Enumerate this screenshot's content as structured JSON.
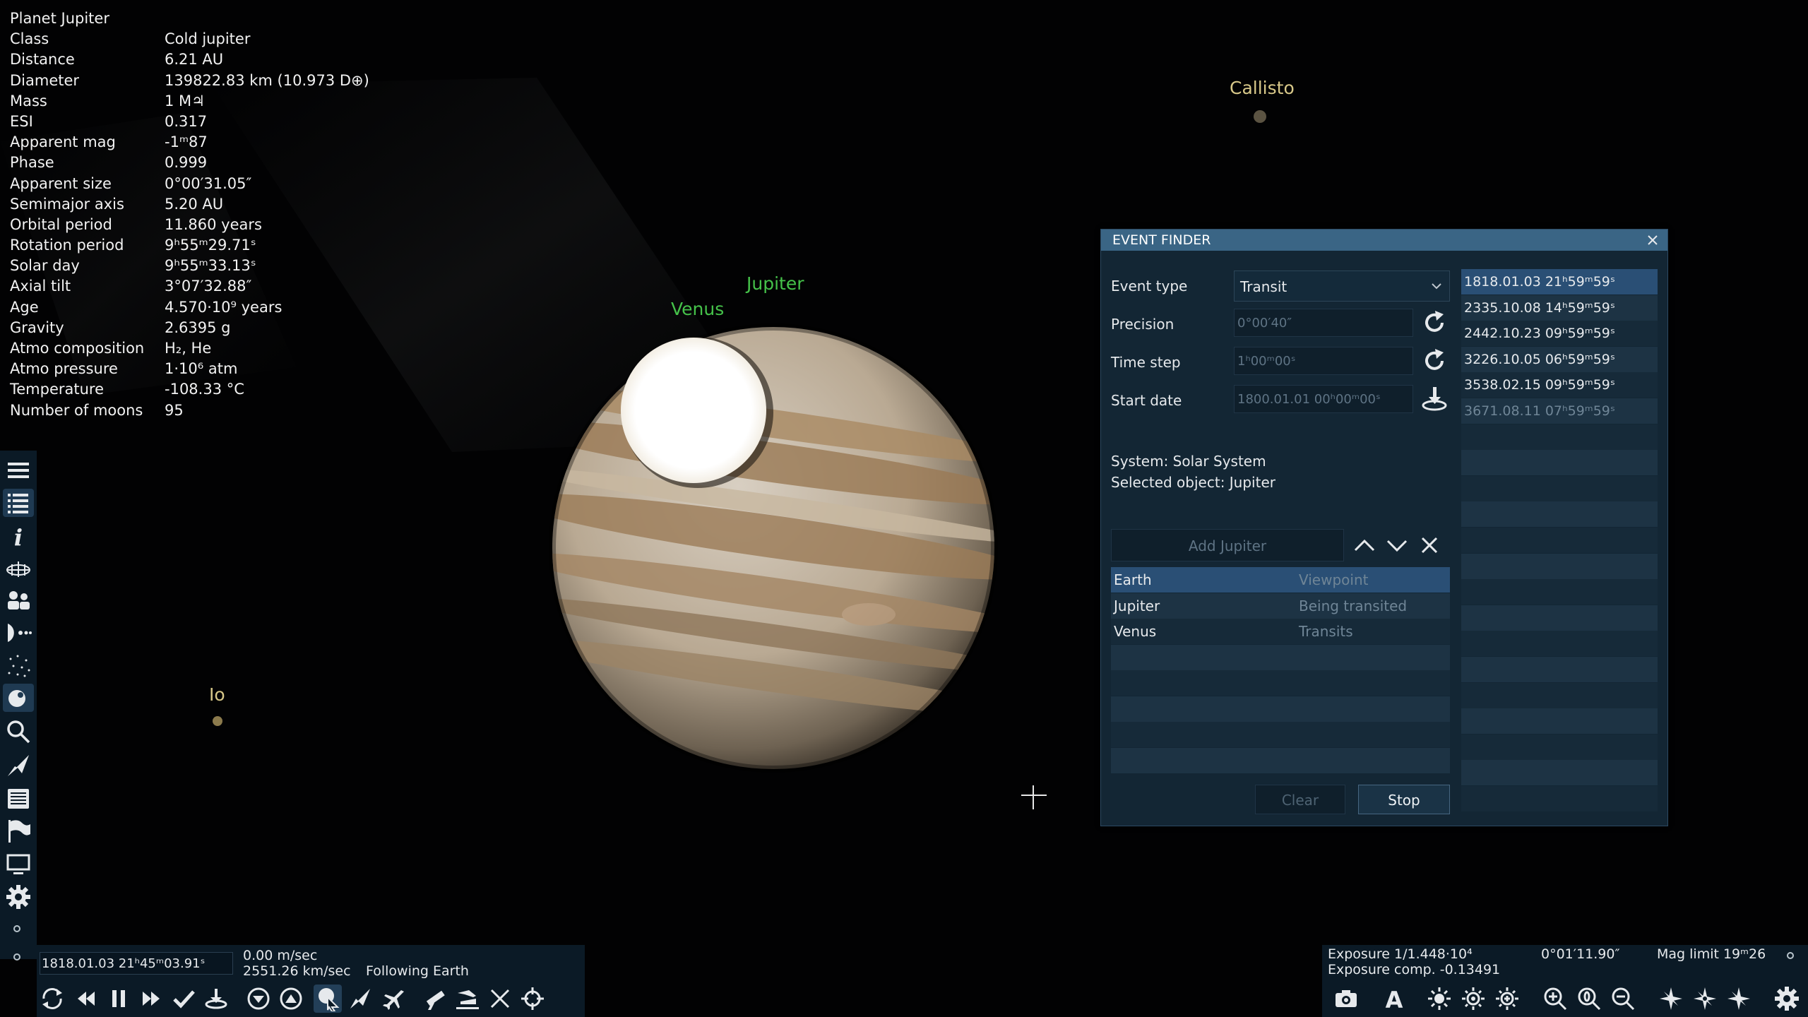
{
  "info": {
    "title": "Planet  Jupiter",
    "rows": [
      {
        "k": "Class",
        "v": "Cold jupiter"
      },
      {
        "k": "Distance",
        "v": "6.21 AU"
      },
      {
        "k": "Diameter",
        "v": "139822.83 km (10.973 D⊕)"
      },
      {
        "k": "Mass",
        "v": "1 M♃"
      },
      {
        "k": "ESI",
        "v": "0.317"
      },
      {
        "k": "Apparent mag",
        "v": "-1ᵐ87"
      },
      {
        "k": "Phase",
        "v": "0.999"
      },
      {
        "k": "Apparent size",
        "v": "0°00′31.05″"
      },
      {
        "k": "Semimajor axis",
        "v": "5.20 AU"
      },
      {
        "k": "Orbital period",
        "v": "11.860 years"
      },
      {
        "k": "Rotation period",
        "v": "9ʰ55ᵐ29.71ˢ"
      },
      {
        "k": "Solar day",
        "v": "9ʰ55ᵐ33.13ˢ"
      },
      {
        "k": "Axial tilt",
        "v": "3°07′32.88″"
      },
      {
        "k": "Age",
        "v": "4.570·10⁹ years"
      },
      {
        "k": "Gravity",
        "v": "2.6395 g"
      },
      {
        "k": "Atmo composition",
        "v": "H₂, He"
      },
      {
        "k": "Atmo pressure",
        "v": "1·10⁶ atm"
      },
      {
        "k": "Temperature",
        "v": "-108.33 °C"
      },
      {
        "k": "Number of moons",
        "v": "95"
      }
    ]
  },
  "labels": {
    "callisto": "Callisto",
    "jupiter": "Jupiter",
    "venus": "Venus",
    "io": "Io"
  },
  "colors": {
    "moon_label": "#d8c889",
    "planet_label": "#45c24a",
    "panel_bg": "#132634",
    "titlebar": "#3a6585",
    "toolbar_bg": "#0b1a26"
  },
  "event_finder": {
    "title": "EVENT FINDER",
    "event_type_label": "Event type",
    "event_type_value": "Transit",
    "precision_label": "Precision",
    "precision_value": "0°00′40″",
    "time_step_label": "Time step",
    "time_step_value": "1ʰ00ᵐ00ˢ",
    "start_date_label": "Start date",
    "start_date_value": "1800.01.01 00ʰ00ᵐ00ˢ",
    "system_text": "System: Solar System",
    "selected_text": "Selected object: Jupiter",
    "add_button": "Add Jupiter",
    "objects": [
      {
        "name": "Earth",
        "role": "Viewpoint"
      },
      {
        "name": "Jupiter",
        "role": "Being transited"
      },
      {
        "name": "Venus",
        "role": "Transits"
      }
    ],
    "clear_button": "Clear",
    "stop_button": "Stop",
    "results": [
      "1818.01.03 21ʰ59ᵐ59ˢ",
      "2335.10.08 14ʰ59ᵐ59ˢ",
      "2442.10.23 09ʰ59ᵐ59ˢ",
      "3226.10.05 06ʰ59ᵐ59ˢ",
      "3538.02.15 09ʰ59ᵐ59ˢ",
      "3671.08.11 07ʰ59ᵐ59ˢ"
    ]
  },
  "timebar": {
    "date": "1818.01.03 21ʰ45ᵐ03.91ˢ",
    "speed": "0.00 m/sec",
    "velocity": "2551.26 km/sec",
    "following": "Following Earth"
  },
  "camerabar": {
    "exposure": "Exposure 1/1.448·10⁴",
    "exposure_comp": "Exposure comp. -0.13491",
    "fov": "0°01′11.90″",
    "mag_limit": "Mag limit 19ᵐ26"
  }
}
